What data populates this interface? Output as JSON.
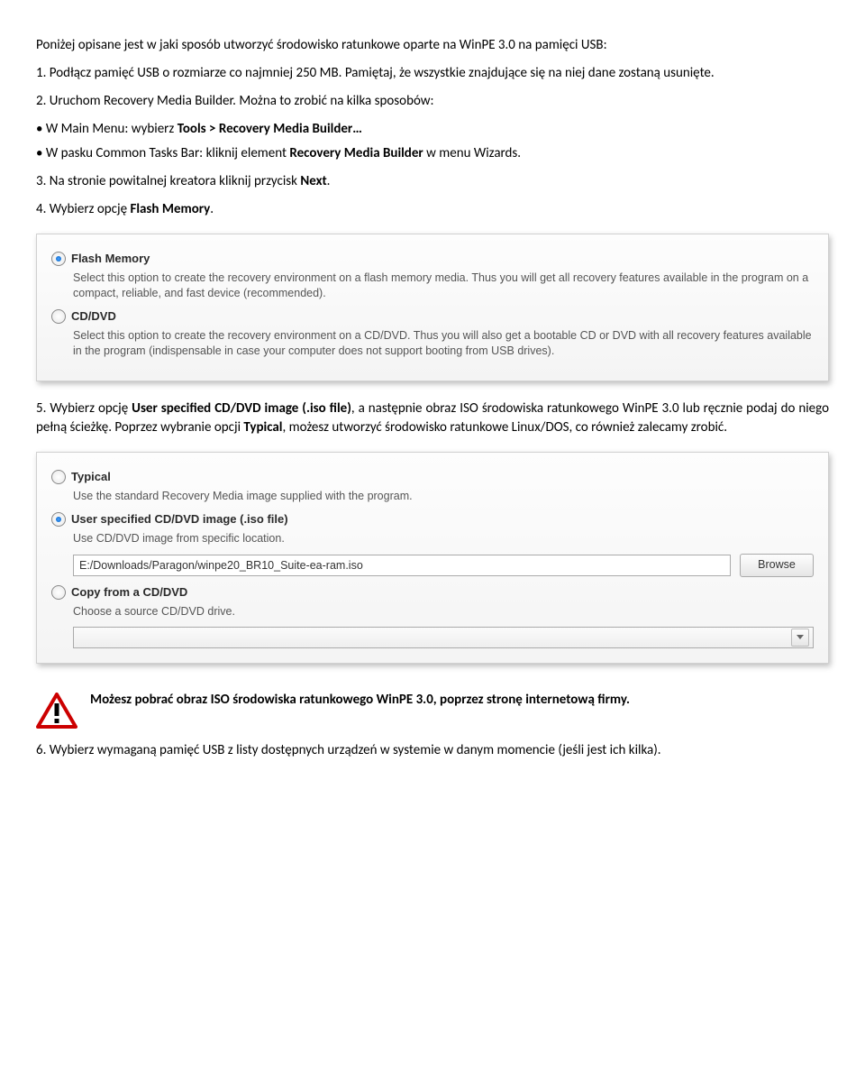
{
  "intro": "Poniżej opisane jest w jaki sposób utworzyć środowisko ratunkowe oparte na WinPE 3.0 na pamięci USB:",
  "step1": "1. Podłącz pamięć USB o rozmiarze co najmniej 250 MB. Pamiętaj, że wszystkie znajdujące się na niej dane zostaną usunięte.",
  "step2": "2. Uruchom Recovery Media Builder. Można to zrobić na kilka sposobów:",
  "bullet1_pre": "• W Main Menu: wybierz ",
  "bullet1_bold": "Tools > Recovery Media Builder…",
  "bullet2_pre": "• W pasku Common Tasks Bar: kliknij element ",
  "bullet2_bold": "Recovery Media Builder",
  "bullet2_post": " w menu Wizards.",
  "step3_pre": "3. Na stronie powitalnej kreatora kliknij przycisk ",
  "step3_bold": "Next",
  "step3_post": ".",
  "step4_pre": "4. Wybierz opcję ",
  "step4_bold": "Flash Memory",
  "step4_post": ".",
  "panel1": {
    "opt1_label": "Flash Memory",
    "opt1_desc": "Select this option to create the recovery environment on a flash memory media. Thus you will get all recovery features available in the program on a compact, reliable, and fast device (recommended).",
    "opt2_label": "CD/DVD",
    "opt2_desc": "Select this option to create the recovery environment on a CD/DVD. Thus you will also get a bootable CD or DVD with all recovery features available in the program (indispensable in case your computer does not support booting from USB drives)."
  },
  "step5_pre": "5. Wybierz opcję ",
  "step5_bold": "User specified CD/DVD image (.iso file)",
  "step5_mid": ", a następnie obraz ISO środowiska ratunkowego WinPE 3.0 lub ręcznie podaj do niego pełną ścieżkę. Poprzez wybranie opcji ",
  "step5_bold2": "Typical",
  "step5_post": ", możesz utworzyć środowisko ratunkowe Linux/DOS, co również zalecamy zrobić.",
  "panel2": {
    "opt1_label": "Typical",
    "opt1_desc": "Use the standard Recovery Media image supplied with the program.",
    "opt2_label": "User specified CD/DVD image (.iso file)",
    "opt2_desc": "Use CD/DVD image from specific location.",
    "path_value": "E:/Downloads/Paragon/winpe20_BR10_Suite-ea-ram.iso",
    "browse_label": "Browse",
    "opt3_label": "Copy from a CD/DVD",
    "opt3_desc": "Choose a source CD/DVD drive."
  },
  "note": "Możesz pobrać obraz ISO środowiska ratunkowego WinPE 3.0, poprzez stronę internetową firmy.",
  "step6": "6. Wybierz wymaganą pamięć USB z listy dostępnych urządzeń w systemie w danym momencie (jeśli jest ich kilka)."
}
